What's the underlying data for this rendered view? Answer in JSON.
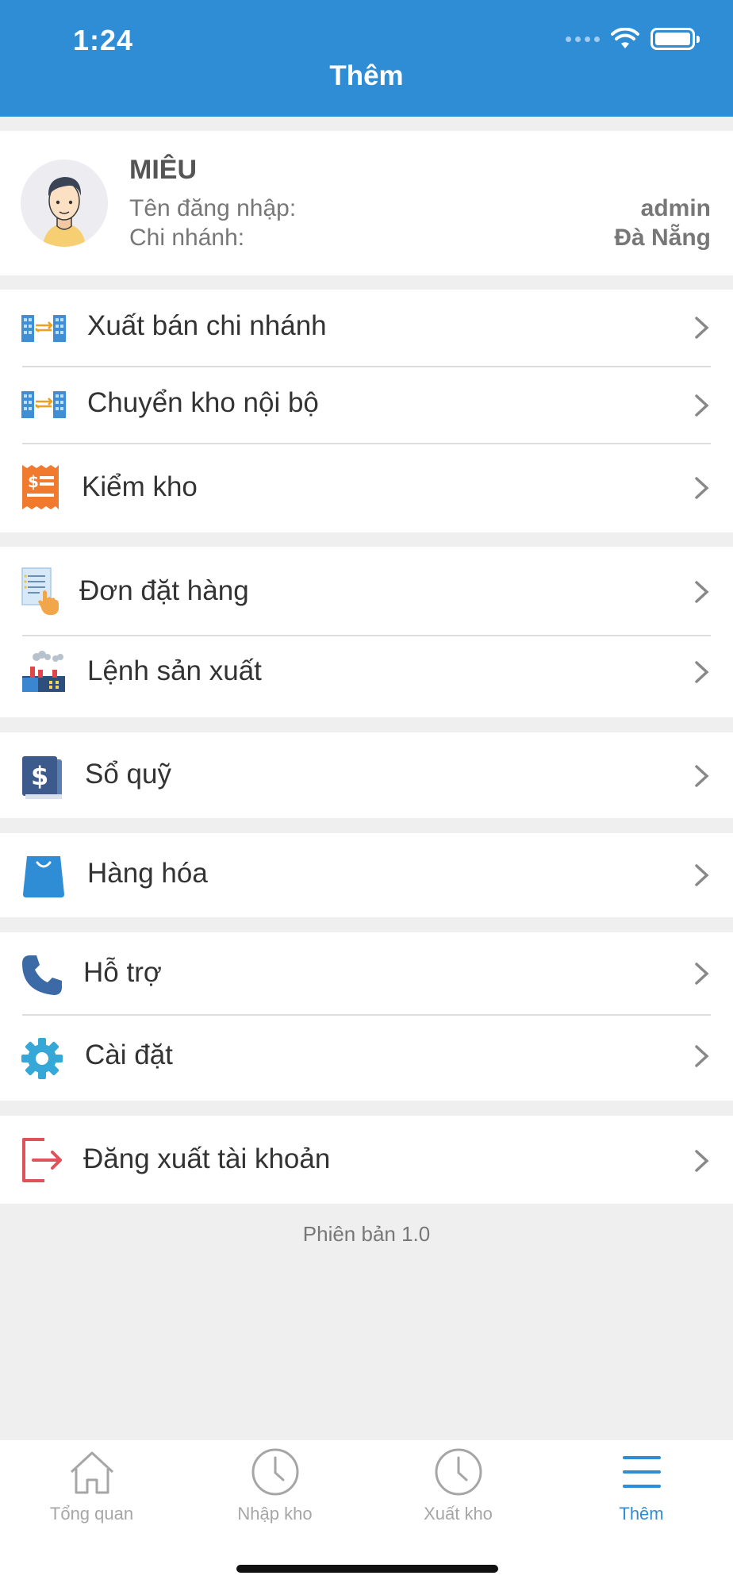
{
  "status_bar": {
    "time": "1:24"
  },
  "header": {
    "title": "Thêm"
  },
  "profile": {
    "name": "MIÊU",
    "login_label": "Tên đăng nhập:",
    "login_value": "admin",
    "branch_label": "Chi nhánh:",
    "branch_value": "Đà Nẵng"
  },
  "menu": {
    "branch_sale": "Xuất bán chi nhánh",
    "internal_transfer": "Chuyển kho nội bộ",
    "stock_check": "Kiểm kho",
    "orders": "Đơn đặt hàng",
    "production_order": "Lệnh sản xuất",
    "cash_book": "Sổ quỹ",
    "goods": "Hàng hóa",
    "support": "Hỗ trợ",
    "settings": "Cài đặt",
    "logout": "Đăng xuất tài khoản"
  },
  "version": "Phiên bản 1.0",
  "tabs": {
    "overview": "Tổng quan",
    "import": "Nhập kho",
    "export": "Xuất kho",
    "more": "Thêm"
  },
  "colors": {
    "header": "#2f8dd6",
    "active_tab": "#2f8dd6",
    "logout_icon": "#e0525a",
    "stock_check_icon": "#f07a2e"
  }
}
